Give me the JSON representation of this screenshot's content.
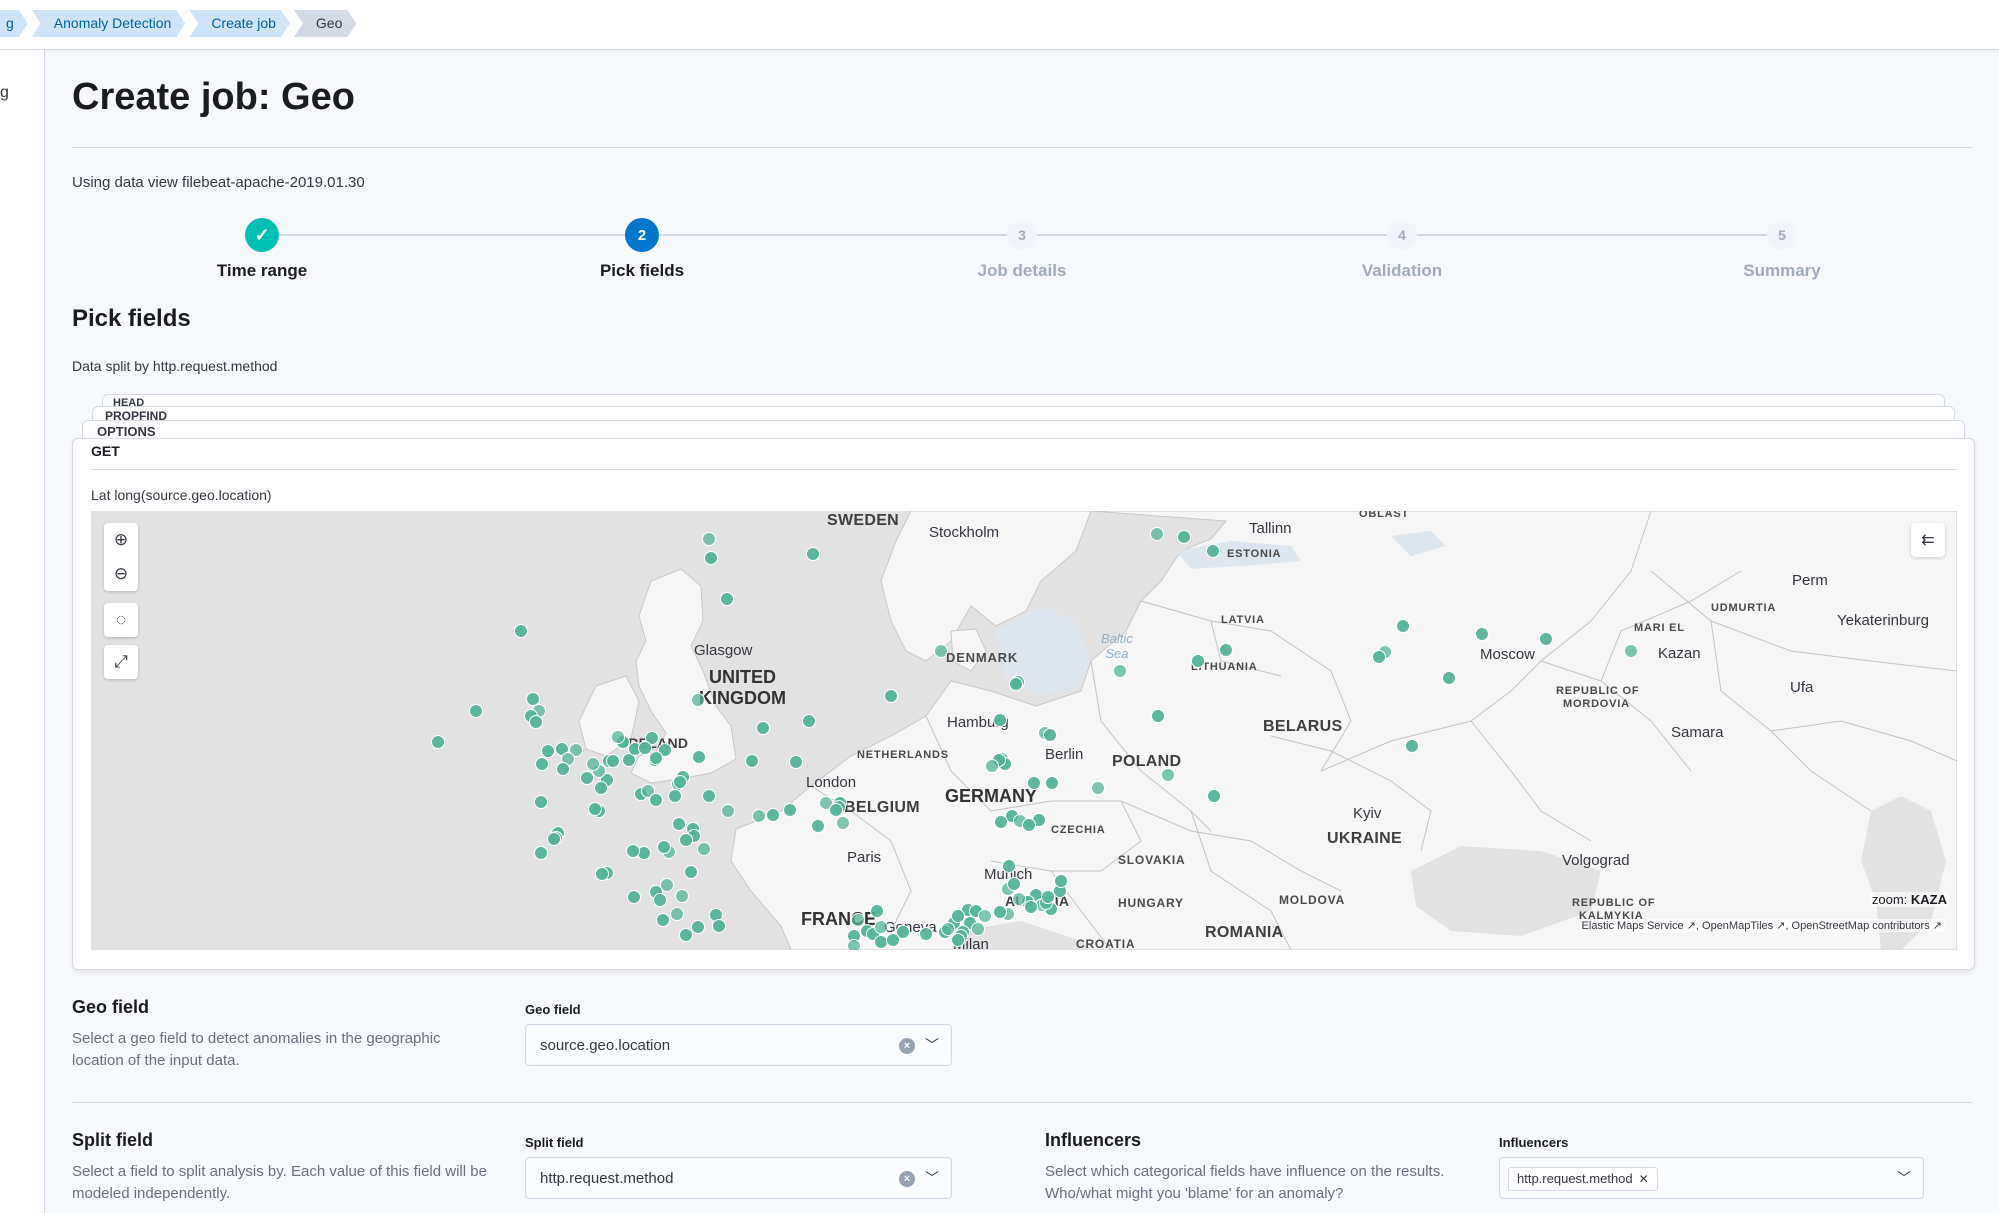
{
  "breadcrumbs": {
    "items": [
      "g",
      "Anomaly Detection",
      "Create job",
      "Geo"
    ]
  },
  "sidebar": {
    "glyph": "g"
  },
  "header": {
    "title": "Create job: Geo"
  },
  "data_view": "Using data view filebeat-apache-2019.01.30",
  "steps": [
    {
      "number": "1",
      "label": "Time range",
      "state": "done"
    },
    {
      "number": "2",
      "label": "Pick fields",
      "state": "current"
    },
    {
      "number": "3",
      "label": "Job details",
      "state": "todo"
    },
    {
      "number": "4",
      "label": "Validation",
      "state": "todo"
    },
    {
      "number": "5",
      "label": "Summary",
      "state": "todo"
    }
  ],
  "pick_fields": {
    "title": "Pick fields",
    "split_description": "Data split by http.request.method",
    "stacked_cards": [
      "HEAD",
      "PROPFIND",
      "OPTIONS"
    ],
    "active_card": {
      "label": "GET",
      "map_caption": "Lat long(source.geo.location)"
    }
  },
  "map": {
    "zoom_label": "zoom:",
    "zoom_value": "KAZA",
    "attribution": "Elastic Maps Service ↗, OpenMapTiles ↗, OpenStreetMap contributors ↗",
    "point_color": "#54b399",
    "icons": {
      "zoom_in": "plus-circle-icon",
      "zoom_out": "minus-circle-icon",
      "locate": "crosshair-icon",
      "fullscreen": "expand-icon",
      "legend": "legend-collapse-icon"
    },
    "labels": {
      "sweden": "SWEDEN",
      "stockholm": "Stockholm",
      "tallinn": "Tallinn",
      "estonia": "ESTONIA",
      "oblast": "OBLAST",
      "latvia": "LATVIA",
      "lithuania": "LITHUANIA",
      "denmark": "DENMARK",
      "baltic": "Baltic\nSea",
      "glasgow": "Glasgow",
      "uk1": "UNITED",
      "uk2": "KINGDOM",
      "ireland": "IRELAND",
      "hamburg": "Hamburg",
      "netherlands": "NETHERLANDS",
      "berlin": "Berlin",
      "poland": "POLAND",
      "london": "London",
      "belgium": "BELGIUM",
      "germany": "GERMANY",
      "czechia": "CZECHIA",
      "belarus": "BELARUS",
      "kyiv": "Kyiv",
      "ukraine": "UKRAINE",
      "slovakia": "SLOVAKIA",
      "paris": "Paris",
      "munich": "Munich",
      "austria": "AUSTRIA",
      "hungary": "HUNGARY",
      "france": "FRANCE",
      "geneva": "Geneva",
      "milan": "Milan",
      "croatia": "CROATIA",
      "moldova": "MOLDOVA",
      "romania": "ROMANIA",
      "moscow": "Moscow",
      "kazan": "Kazan",
      "mari_el": "MARI EL",
      "udmurtia": "UDMURTIA",
      "perm": "Perm",
      "yekaterinburg": "Yekaterinburg",
      "mordovia1": "REPUBLIC OF",
      "mordovia2": "MORDOVIA",
      "ufa": "Ufa",
      "samara": "Samara",
      "volgograd": "Volgograd",
      "kalmykia1": "REPUBLIC OF",
      "kalmykia2": "KALMYKIA"
    }
  },
  "geo_field": {
    "title": "Geo field",
    "description": "Select a geo field to detect anomalies in the geographic location of the input data.",
    "label": "Geo field",
    "value": "source.geo.location"
  },
  "split_field": {
    "title": "Split field",
    "description": "Select a field to split analysis by. Each value of this field will be modeled independently.",
    "label": "Split field",
    "value": "http.request.method"
  },
  "influencers": {
    "title": "Influencers",
    "description": "Select which categorical fields have influence on the results. Who/what might you 'blame' for an anomaly?",
    "label": "Influencers",
    "selected": [
      "http.request.method"
    ]
  }
}
